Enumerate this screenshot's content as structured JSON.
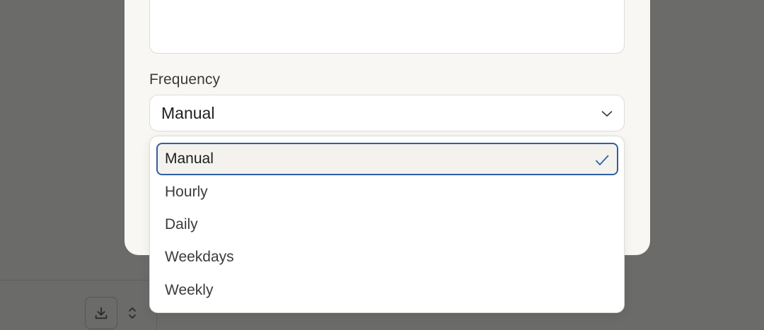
{
  "frequency": {
    "label": "Frequency",
    "selected_value": "Manual",
    "options": [
      "Manual",
      "Hourly",
      "Daily",
      "Weekdays",
      "Weekly"
    ]
  },
  "colors": {
    "overlay": "#6b6b69",
    "modal_bg": "#f8f7f4",
    "focus_ring": "#2f5fa6",
    "selected_bg": "#f3f2ec"
  },
  "icons": {
    "chevron": "chevron-down-icon",
    "check": "check-icon",
    "download": "download-icon",
    "updown": "chevron-up-down-icon"
  }
}
